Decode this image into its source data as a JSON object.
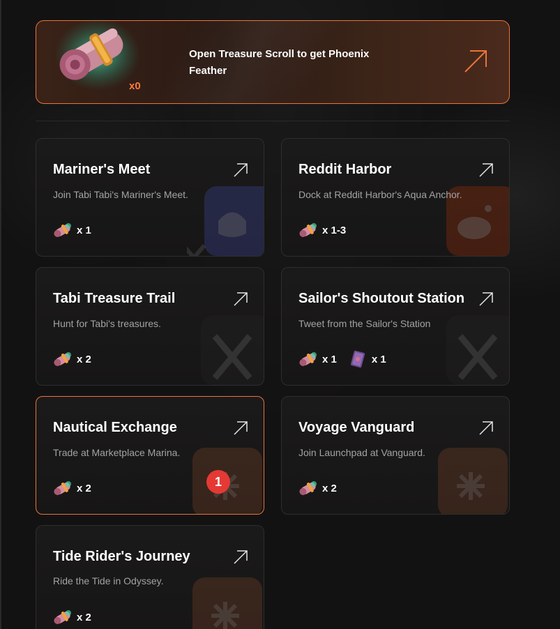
{
  "banner": {
    "title": "Open Treasure Scroll to get Phoenix Feather",
    "count": "x0"
  },
  "cards": [
    {
      "title": "Mariner's Meet",
      "desc": "Join Tabi Tabi's Mariner's Meet.",
      "rewards": [
        {
          "icon": "scroll-icon",
          "qty": "x 1"
        }
      ],
      "platform": "discord"
    },
    {
      "title": "Reddit Harbor",
      "desc": "Dock at Reddit Harbor's Aqua Anchor.",
      "rewards": [
        {
          "icon": "scroll-icon",
          "qty": "x 1-3"
        }
      ],
      "platform": "reddit"
    },
    {
      "title": "Tabi Treasure Trail",
      "desc": "Hunt for Tabi's treasures.",
      "rewards": [
        {
          "icon": "scroll-icon",
          "qty": "x 2"
        }
      ],
      "platform": "x"
    },
    {
      "title": "Sailor's Shoutout Station",
      "desc": "Tweet from the Sailor's Station",
      "rewards": [
        {
          "icon": "scroll-icon",
          "qty": "x 1"
        },
        {
          "icon": "book-icon",
          "qty": "x 1"
        }
      ],
      "platform": "x"
    },
    {
      "title": "Nautical Exchange",
      "desc": "Trade at Marketplace Marina.",
      "rewards": [
        {
          "icon": "scroll-icon",
          "qty": "x 2"
        }
      ],
      "platform": "tabi"
    },
    {
      "title": "Voyage Vanguard",
      "desc": "Join Launchpad at Vanguard.",
      "rewards": [
        {
          "icon": "scroll-icon",
          "qty": "x 2"
        }
      ],
      "platform": "tabi"
    },
    {
      "title": "Tide Rider's Journey",
      "desc": "Ride the Tide in Odyssey.",
      "rewards": [
        {
          "icon": "scroll-icon",
          "qty": "x 2"
        }
      ],
      "platform": "tabi"
    }
  ],
  "badge": "1",
  "colors": {
    "accent": "#e8743b",
    "badge": "#e53935",
    "bg": "#131212"
  }
}
